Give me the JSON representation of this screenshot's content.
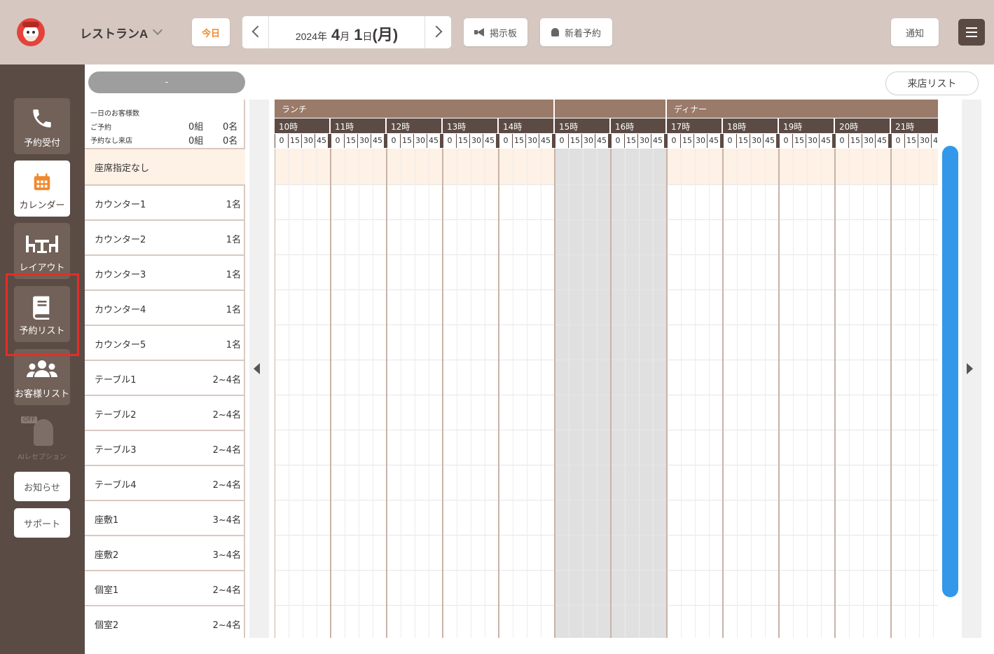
{
  "header": {
    "store_name": "レストランA",
    "today_label": "今日",
    "date": {
      "year_text": "2024年",
      "month_num": "4",
      "month_unit": "月",
      "day_num": "1",
      "day_unit": "日",
      "weekday": "(月)"
    },
    "board_label": "掲示板",
    "new_reservation_label": "新着予約",
    "notify_label": "通知"
  },
  "sidebar": {
    "items": [
      {
        "label": "予約受付",
        "icon": "phone-icon"
      },
      {
        "label": "カレンダー",
        "icon": "calendar-icon",
        "active": true
      },
      {
        "label": "レイアウト",
        "icon": "table-chairs-icon"
      },
      {
        "label": "予約リスト",
        "icon": "book-icon",
        "highlighted": true
      },
      {
        "label": "お客様リスト",
        "icon": "people-icon"
      }
    ],
    "ai_reception": {
      "off_badge": "OFF",
      "label": "AIレセプション"
    },
    "notice_label": "お知らせ",
    "support_label": "サポート"
  },
  "toolbar": {
    "pill_label": "-",
    "visit_list_label": "来店リスト"
  },
  "summary": {
    "title": "一日のお客様数",
    "reserved_label": "ご予約",
    "reserved_groups": "0組",
    "reserved_people": "0名",
    "walkin_label": "予約なし来店",
    "walkin_groups": "0組",
    "walkin_people": "0名"
  },
  "seats": [
    {
      "name": "座席指定なし",
      "capacity": ""
    },
    {
      "name": "カウンター1",
      "capacity": "1名"
    },
    {
      "name": "カウンター2",
      "capacity": "1名"
    },
    {
      "name": "カウンター3",
      "capacity": "1名"
    },
    {
      "name": "カウンター4",
      "capacity": "1名"
    },
    {
      "name": "カウンター5",
      "capacity": "1名"
    },
    {
      "name": "テーブル1",
      "capacity": "2~4名"
    },
    {
      "name": "テーブル2",
      "capacity": "2~4名"
    },
    {
      "name": "テーブル3",
      "capacity": "2~4名"
    },
    {
      "name": "テーブル4",
      "capacity": "2~4名"
    },
    {
      "name": "座敷1",
      "capacity": "3~4名"
    },
    {
      "name": "座敷2",
      "capacity": "3~4名"
    },
    {
      "name": "個室1",
      "capacity": "2~4名"
    },
    {
      "name": "個室2",
      "capacity": "2~4名"
    }
  ],
  "timeline": {
    "periods": [
      "ランチ",
      "",
      "ディナー"
    ],
    "hours": [
      "10時",
      "11時",
      "12時",
      "13時",
      "14時",
      "15時",
      "16時",
      "17時",
      "18時",
      "19時",
      "20時",
      "21時"
    ],
    "minutes": [
      "0",
      "15",
      "30",
      "45"
    ],
    "closed_hours": [
      "15時",
      "16時"
    ]
  },
  "colors": {
    "topbar": "#d6c8c1",
    "sidebar": "#5a4b45",
    "accent_orange": "#f0892d",
    "header_brown": "#5c4b44",
    "period_brown": "#9a7a68",
    "scroll_blue": "#3398ea",
    "highlight_red": "#e52d27"
  }
}
